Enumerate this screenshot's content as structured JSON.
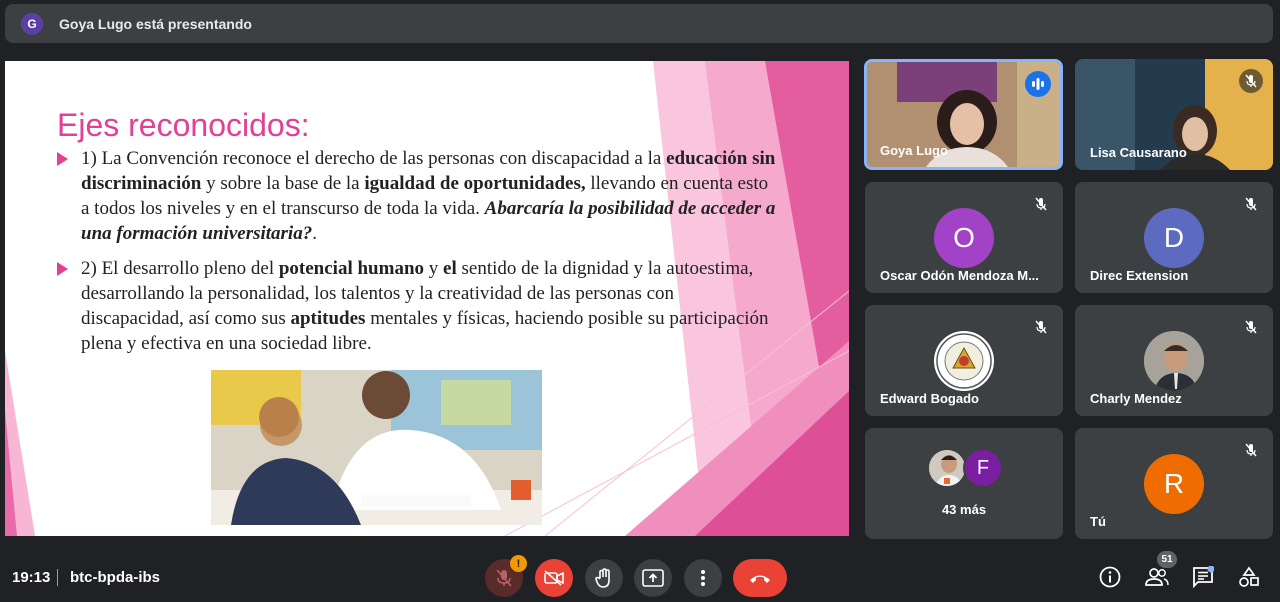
{
  "topbar": {
    "avatar_letter": "G",
    "presenting_text": "Goya Lugo está presentando"
  },
  "slide": {
    "title": "Ejes reconocidos:",
    "bullet1": {
      "p1": "1) La Convención reconoce el derecho de las personas con discapacidad a la ",
      "b1": "educación sin discriminación",
      "p2": " y sobre la base de la ",
      "b2": "igualdad de oportunidades,",
      "p3": " llevando en cuenta esto a todos los niveles y en el transcurso de toda la vida. ",
      "bi": "Abarcaría la posibilidad de acceder a una formación universitaria?",
      "p4": "."
    },
    "bullet2": {
      "p1": "2) El desarrollo pleno del ",
      "b1": "potencial humano",
      "p2": " y ",
      "b2": "el",
      "p3": " sentido de la dignidad y la autoestima, desarrollando la personalidad, los talentos y la creatividad de las personas con discapacidad, así como sus ",
      "b3": "aptitudes",
      "p4": " mentales y físicas, haciendo posible su participación plena y efectiva en una sociedad libre."
    },
    "colors": {
      "accent": "#e23f95",
      "pink_light": "#f9c6de",
      "pink_mid": "#f29ac4",
      "pink_dark": "#dd4f97"
    }
  },
  "participants": [
    {
      "name": "Goya Lugo",
      "type": "video",
      "speaking": true
    },
    {
      "name": "Lisa Causarano",
      "type": "video",
      "muted": true
    },
    {
      "name": "Oscar Odón Mendoza M...",
      "type": "avatar",
      "letter": "O",
      "color": "#a142c7",
      "muted": true
    },
    {
      "name": "Direc Extension",
      "type": "avatar",
      "letter": "D",
      "color": "#5c6bc0",
      "muted": true
    },
    {
      "name": "Edward Bogado",
      "type": "logo",
      "muted": true
    },
    {
      "name": "Charly Mendez",
      "type": "photo",
      "muted": true
    },
    {
      "name": "43 más",
      "type": "overflow",
      "letter": "F",
      "color": "#7b1fa2"
    },
    {
      "name": "Tú",
      "type": "avatar",
      "letter": "R",
      "color": "#ef6c00",
      "muted": true
    }
  ],
  "bottom": {
    "time": "19:13",
    "meeting_code": "btc-bpda-ibs",
    "mic_badge": "!",
    "participants_count": "51",
    "icons": [
      "mic-off-icon",
      "camera-off-icon",
      "raise-hand-icon",
      "present-icon",
      "more-options-icon",
      "hang-up-icon",
      "info-icon",
      "people-icon",
      "chat-icon",
      "activities-icon"
    ]
  }
}
